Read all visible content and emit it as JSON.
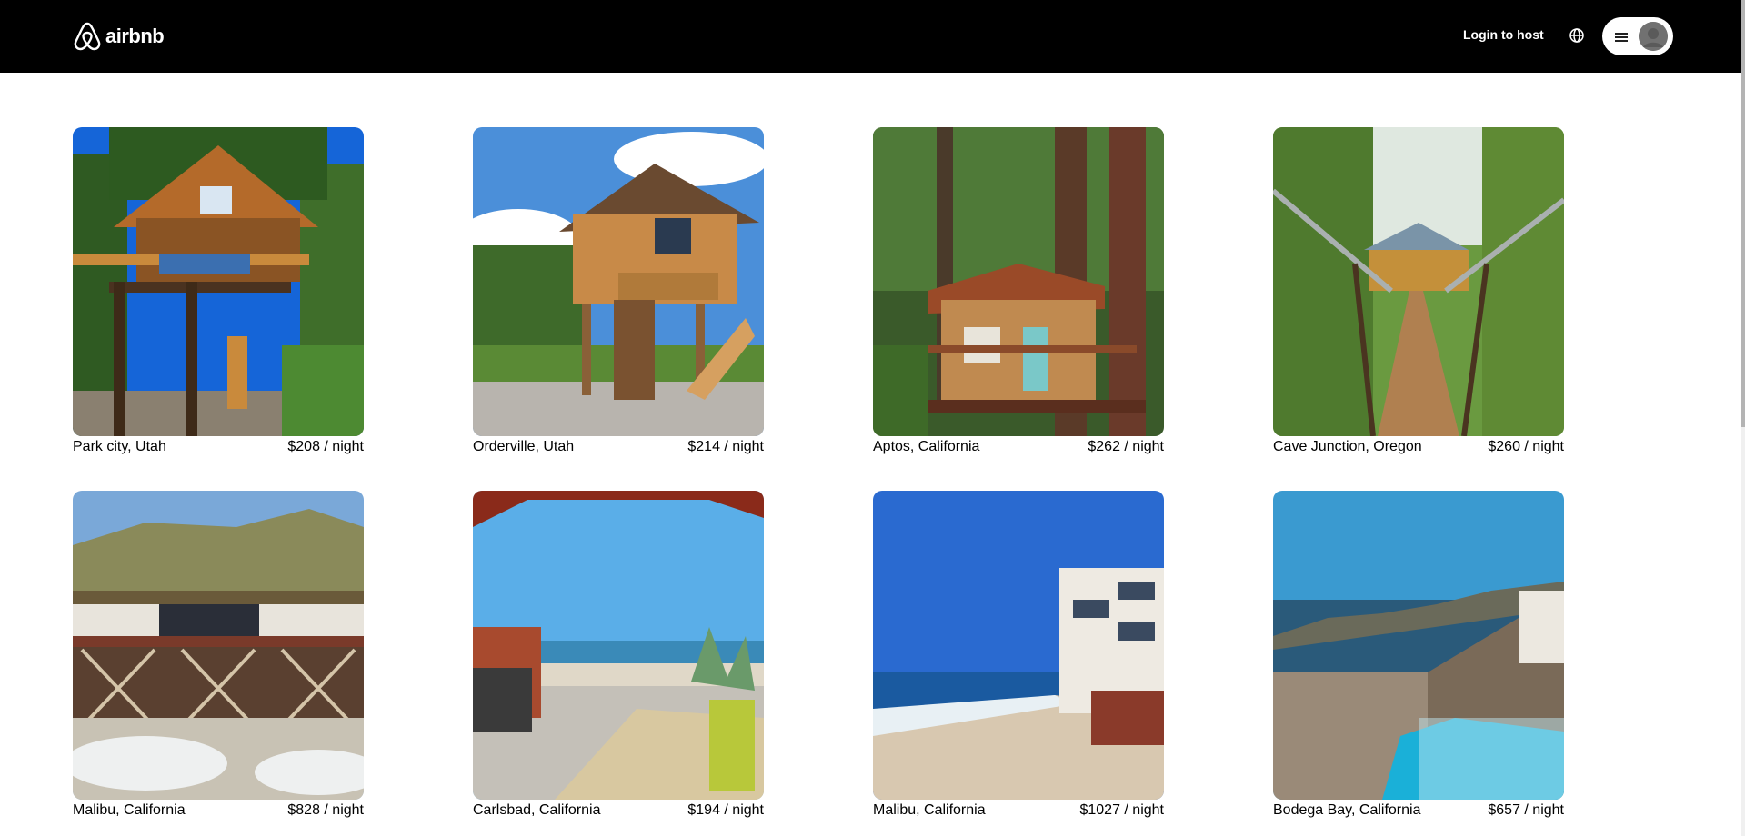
{
  "header": {
    "logo_text": "airbnb",
    "host_link": "Login to host",
    "globe_icon": "globe-icon",
    "menu_icon": "hamburger-icon",
    "avatar_icon": "user-avatar-icon"
  },
  "listings": [
    {
      "location": "Park city, Utah",
      "price": "$208 / night"
    },
    {
      "location": "Orderville, Utah",
      "price": "$214 / night"
    },
    {
      "location": "Aptos, California",
      "price": "$262 / night"
    },
    {
      "location": "Cave Junction, Oregon",
      "price": "$260 / night"
    },
    {
      "location": "Malibu, California",
      "price": "$828 / night"
    },
    {
      "location": "Carlsbad, California",
      "price": "$194 / night"
    },
    {
      "location": "Malibu, California",
      "price": "$1027 / night"
    },
    {
      "location": "Bodega Bay, California",
      "price": "$657 / night"
    }
  ]
}
